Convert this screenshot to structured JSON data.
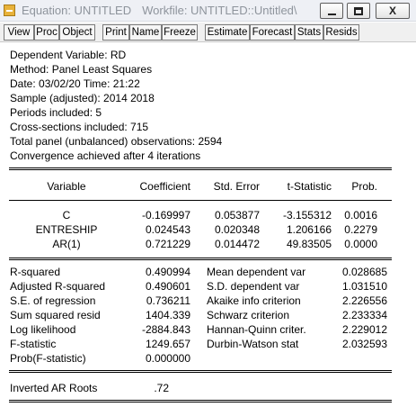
{
  "window": {
    "title": "Equation: UNTITLED",
    "workfile": "Workfile: UNTITLED::Untitled\\",
    "close_label": "X"
  },
  "toolbar": {
    "buttons": [
      "View",
      "Proc",
      "Object",
      "Print",
      "Name",
      "Freeze",
      "Estimate",
      "Forecast",
      "Stats",
      "Resids"
    ]
  },
  "header": {
    "lines": [
      "Dependent Variable: RD",
      "Method: Panel Least Squares",
      "Date: 03/02/20   Time: 21:22",
      "Sample (adjusted): 2014 2018",
      "Periods included: 5",
      "Cross-sections included: 715",
      "Total panel (unbalanced) observations: 2594",
      "Convergence achieved after 4 iterations"
    ]
  },
  "table": {
    "columns": [
      "Variable",
      "Coefficient",
      "Std. Error",
      "t-Statistic",
      "Prob."
    ],
    "rows": [
      {
        "variable": "C",
        "coefficient": "-0.169997",
        "std_error": "0.053877",
        "t_statistic": "-3.155312",
        "prob": "0.0016"
      },
      {
        "variable": "ENTRESHIP",
        "coefficient": "0.024543",
        "std_error": "0.020348",
        "t_statistic": "1.206166",
        "prob": "0.2279"
      },
      {
        "variable": "AR(1)",
        "coefficient": "0.721229",
        "std_error": "0.014472",
        "t_statistic": "49.83505",
        "prob": "0.0000"
      }
    ]
  },
  "stats": {
    "left": [
      {
        "label": "R-squared",
        "value": "0.490994"
      },
      {
        "label": "Adjusted R-squared",
        "value": "0.490601"
      },
      {
        "label": "S.E. of regression",
        "value": "0.736211"
      },
      {
        "label": "Sum squared resid",
        "value": "1404.339"
      },
      {
        "label": "Log likelihood",
        "value": "-2884.843"
      },
      {
        "label": "F-statistic",
        "value": "1249.657"
      },
      {
        "label": "Prob(F-statistic)",
        "value": "0.000000"
      }
    ],
    "right": [
      {
        "label": "Mean dependent var",
        "value": "0.028685"
      },
      {
        "label": "S.D. dependent var",
        "value": "1.031510"
      },
      {
        "label": "Akaike info criterion",
        "value": "2.226556"
      },
      {
        "label": "Schwarz criterion",
        "value": "2.233334"
      },
      {
        "label": "Hannan-Quinn criter.",
        "value": "2.229012"
      },
      {
        "label": "Durbin-Watson stat",
        "value": "2.032593"
      }
    ]
  },
  "roots": {
    "label": "Inverted AR Roots",
    "value": ".72"
  }
}
